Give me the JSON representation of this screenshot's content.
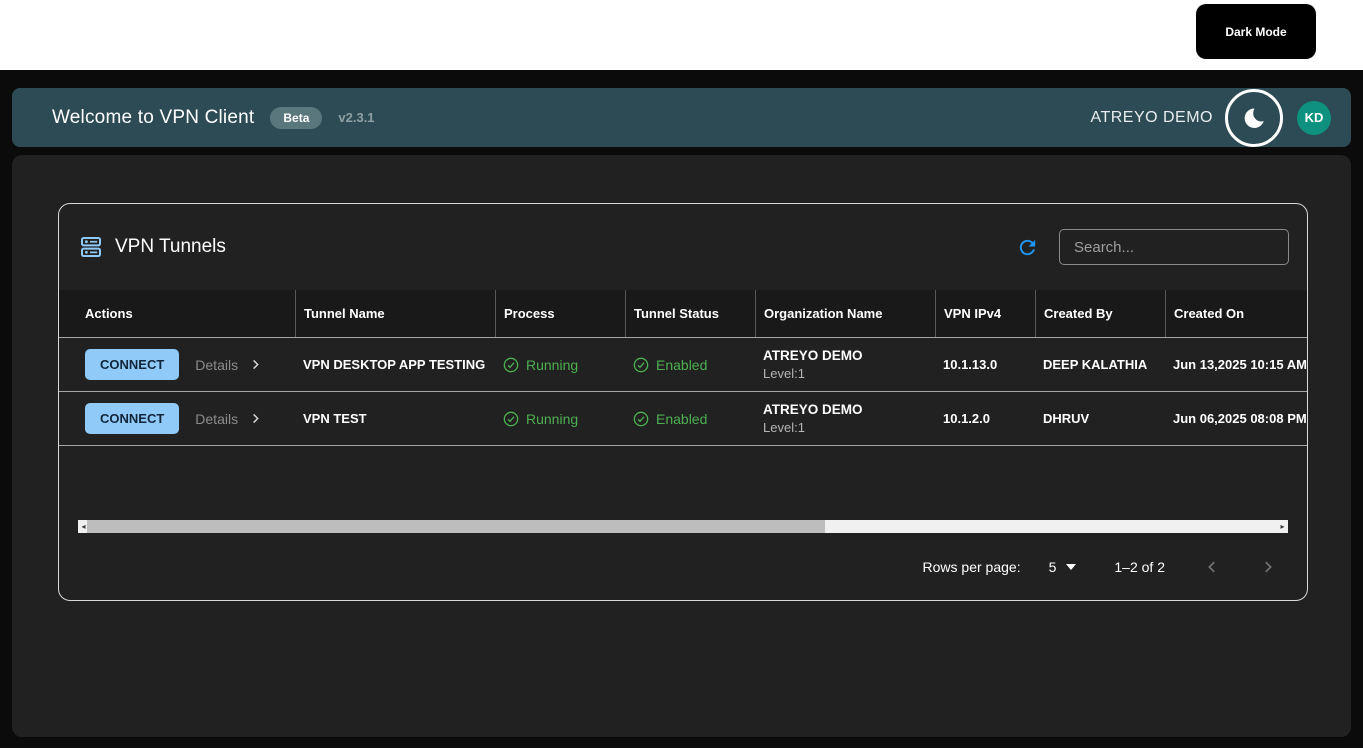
{
  "tooltip": {
    "label": "Dark Mode"
  },
  "header": {
    "title": "Welcome to VPN Client",
    "badge": "Beta",
    "version": "v2.3.1",
    "account_name": "ATREYO DEMO",
    "avatar_initials": "KD",
    "theme_toggle_icon": "moon-icon"
  },
  "card": {
    "title": "VPN Tunnels",
    "title_icon": "tunnels-icon",
    "refresh_icon": "refresh-icon",
    "search_placeholder": "Search..."
  },
  "table": {
    "columns": [
      "Actions",
      "Tunnel Name",
      "Process",
      "Tunnel Status",
      "Organization Name",
      "VPN IPv4",
      "Created By",
      "Created On"
    ],
    "rows": [
      {
        "connect_label": "CONNECT",
        "details_label": "Details",
        "tunnel_name": "VPN DESKTOP APP TESTING",
        "process": "Running",
        "tunnel_status": "Enabled",
        "organization_name": "ATREYO DEMO",
        "organization_level": "Level:1",
        "vpn_ipv4": "10.1.13.0",
        "created_by": "DEEP KALATHIA",
        "created_on": "Jun 13,2025 10:15 AM"
      },
      {
        "connect_label": "CONNECT",
        "details_label": "Details",
        "tunnel_name": "VPN TEST",
        "process": "Running",
        "tunnel_status": "Enabled",
        "organization_name": "ATREYO DEMO",
        "organization_level": "Level:1",
        "vpn_ipv4": "10.1.2.0",
        "created_by": "DHRUV",
        "created_on": "Jun 06,2025 08:08 PM"
      }
    ]
  },
  "pagination": {
    "rows_per_page_label": "Rows per page:",
    "rows_per_page_value": "5",
    "range_label": "1–2 of 2"
  },
  "colors": {
    "header_teal": "#2c4b54",
    "accent_blue": "#90caf9",
    "refresh_blue": "#2196f3",
    "status_green": "#4caf50",
    "avatar_teal": "#0f9180",
    "panel_dark": "#212121",
    "app_black": "#0b0b0b"
  }
}
